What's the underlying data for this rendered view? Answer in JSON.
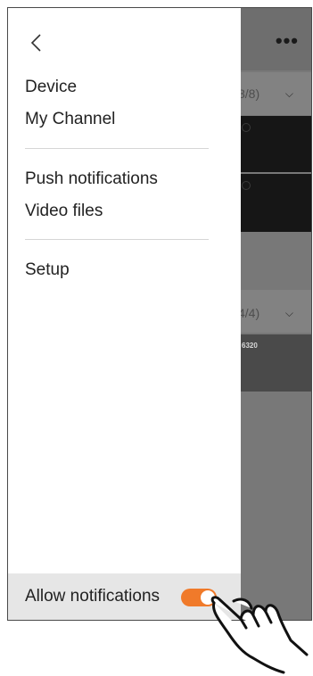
{
  "drawer": {
    "back_icon": "chevron-left-icon",
    "menu": {
      "device": "Device",
      "my_channel": "My Channel",
      "push_notifications": "Push notifications",
      "video_files": "Video files",
      "setup": "Setup"
    },
    "notifications": {
      "label": "Allow notifications",
      "enabled": true
    }
  },
  "background_app": {
    "more_icon": "more-horizontal-icon",
    "group1_count": "8/8)",
    "group2_count": "4/4)",
    "camera_label": "6320"
  },
  "colors": {
    "accent": "#f07a2a",
    "overlay": "#787878",
    "drawer_bg": "#ffffff",
    "notif_bar_bg": "#e6e6e6"
  }
}
